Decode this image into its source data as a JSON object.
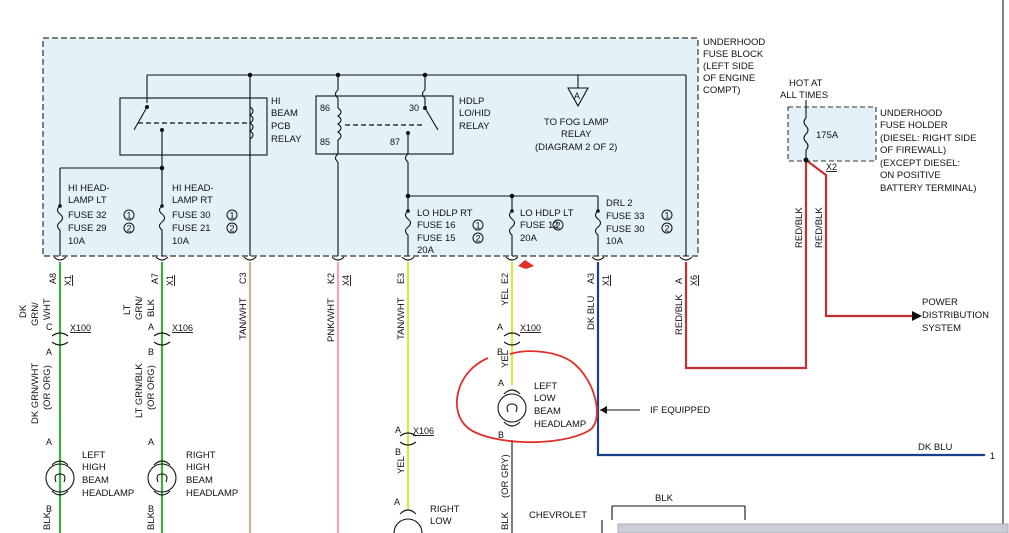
{
  "fuse_block": {
    "label": [
      "UNDERHOOD",
      "FUSE BLOCK",
      "(LEFT SIDE",
      "OF ENGINE",
      "COMPT)"
    ],
    "hi_beam_relay": [
      "HI",
      "BEAM",
      "PCB",
      "RELAY"
    ],
    "hdlp_relay": [
      "HDLP",
      "LO/HID",
      "RELAY"
    ],
    "relay_pins": [
      "86",
      "85",
      "30",
      "87"
    ],
    "fog_lamp_ref": [
      "TO FOG LAMP",
      "RELAY",
      "(DIAGRAM 2 OF 2)"
    ],
    "fog_lamp_marker": "A",
    "fuses": [
      {
        "name": "hi-head-lamp-lt",
        "lines": [
          "HI HEAD-",
          "LAMP LT",
          "FUSE 32",
          "FUSE 29",
          "10A"
        ],
        "circ": [
          "1",
          "2"
        ]
      },
      {
        "name": "hi-head-lamp-rt",
        "lines": [
          "HI HEAD-",
          "LAMP RT",
          "FUSE 30",
          "FUSE 21",
          "10A"
        ],
        "circ": [
          "1",
          "2"
        ]
      },
      {
        "name": "lo-hdlp-rt",
        "lines": [
          "LO HDLP RT",
          "FUSE 16",
          "FUSE 15",
          "20A"
        ],
        "circ": [
          "1",
          "2"
        ]
      },
      {
        "name": "lo-hdlp-lt",
        "lines": [
          "LO HDLP LT",
          "FUSE 12",
          "20A"
        ],
        "circ": [
          "2"
        ]
      },
      {
        "name": "drl-2",
        "lines": [
          "DRL 2",
          "FUSE 33",
          "FUSE 30",
          "10A"
        ],
        "circ": [
          "1",
          "2"
        ]
      }
    ]
  },
  "fuse_holder": {
    "hot_label": [
      "HOT AT",
      "ALL TIMES"
    ],
    "rating": "175A",
    "label": [
      "UNDERHOOD",
      "FUSE HOLDER",
      "(DIESEL: RIGHT SIDE",
      "OF FIREWALL)",
      "(EXCEPT DIESEL:",
      "ON POSITIVE",
      "BATTERY TERMINAL)"
    ],
    "pin": "X2",
    "wires": [
      "RED/BLK",
      "RED/BLK"
    ]
  },
  "power_distribution": [
    "POWER",
    "DISTRIBUTION",
    "SYSTEM"
  ],
  "connectors": [
    {
      "pin": "A8",
      "conn": "X1"
    },
    {
      "pin": "A7",
      "conn": "X1"
    },
    {
      "pin": "C3",
      "conn": ""
    },
    {
      "pin": "K2",
      "conn": "X4"
    },
    {
      "pin": "E3",
      "conn": ""
    },
    {
      "pin": "E2",
      "conn": ""
    },
    {
      "pin": "A3",
      "conn": "X1"
    },
    {
      "pin": "A",
      "conn": "X6"
    }
  ],
  "wires": {
    "c1": [
      "DK",
      "GRN/",
      "WHT"
    ],
    "c2": [
      "LT",
      "GRN/",
      "BLK"
    ],
    "c3": "TAN/WHT",
    "c4": "PNK/WHT",
    "c5": "TAN/WHT",
    "c6": "YEL",
    "c7": "DK BLU",
    "c8": "RED/BLK",
    "lower1": [
      "DK GRN/WHT",
      "(OR ORG)"
    ],
    "lower2": [
      "LT GRN/BLK",
      "(OR ORG)"
    ],
    "lower6": "YEL",
    "lower6b": [
      "(OR GRY)"
    ],
    "lower5": "YEL",
    "bottom_c1": "BLK",
    "bottom_c2": "BLK",
    "bottom_c6": "BLK",
    "dk_blu_out": "DK BLU",
    "dk_blu_ref": "1"
  },
  "inline_connectors": [
    {
      "pin_top": "C",
      "pin_bot": "A",
      "name": "X100"
    },
    {
      "pin_top": "A",
      "pin_bot": "B",
      "name": "X106"
    },
    {
      "pin_top": "A",
      "pin_bot": "B",
      "name": "X100"
    },
    {
      "pin_top": "A",
      "pin_bot": "B",
      "name": "X106"
    }
  ],
  "lamps": {
    "left_high": [
      "LEFT",
      "HIGH",
      "BEAM",
      "HEADLAMP"
    ],
    "right_high": [
      "RIGHT",
      "HIGH",
      "BEAM",
      "HEADLAMP"
    ],
    "left_low": [
      "LEFT",
      "LOW",
      "BEAM",
      "HEADLAMP"
    ],
    "right_low": [
      "RIGHT",
      "LOW"
    ],
    "pins": [
      "A",
      "B"
    ]
  },
  "if_equipped": "IF EQUIPPED",
  "chevrolet": "CHEVROLET",
  "blk_bottom": "BLK",
  "colors": {
    "panel": "#e3f1f9",
    "green": "#3fae3f",
    "tan": "#c8b48a",
    "pink": "#f2a6b4",
    "yellow": "#e2e24a",
    "blue": "#1b3f8c",
    "red": "#c23030",
    "annotation": "#e0302a"
  }
}
